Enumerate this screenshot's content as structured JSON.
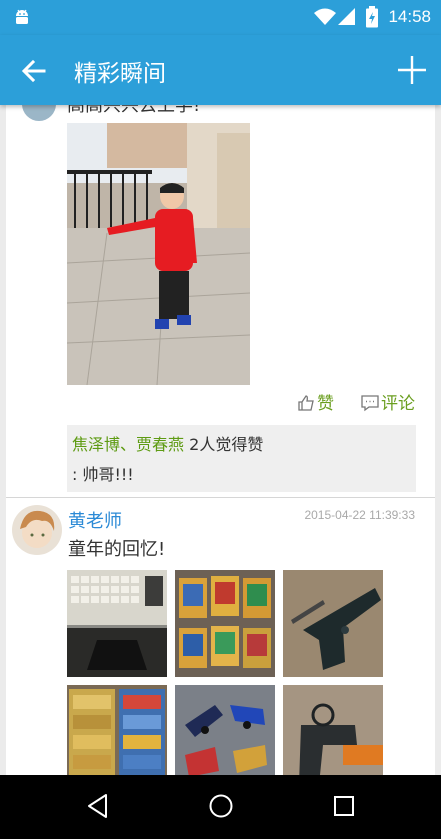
{
  "status": {
    "time": "14:58"
  },
  "appbar": {
    "title": "精彩瞬间"
  },
  "post1": {
    "partial_text": "高高兴兴去上学!",
    "like_label": "赞",
    "comment_label": "评论",
    "liker1": "焦泽博",
    "liker_sep": "、",
    "liker2": "贾春燕",
    "like_count_text": "2人觉得赞",
    "comment": ": 帅哥!!!"
  },
  "post2": {
    "author": "黄老师",
    "date": "2015-04-22 11:39:33",
    "text": "童年的回忆!"
  },
  "icons": {
    "status": [
      "android-icon",
      "wifi-icon",
      "signal-icon",
      "battery-icon"
    ],
    "appbar": [
      "back-arrow-icon",
      "add-icon"
    ],
    "nav": [
      "back-nav-icon",
      "home-nav-icon",
      "recents-nav-icon"
    ]
  },
  "colors": {
    "primary": "#2c9fd9",
    "liker": "#5e9b13",
    "author": "#2b8ad6"
  }
}
